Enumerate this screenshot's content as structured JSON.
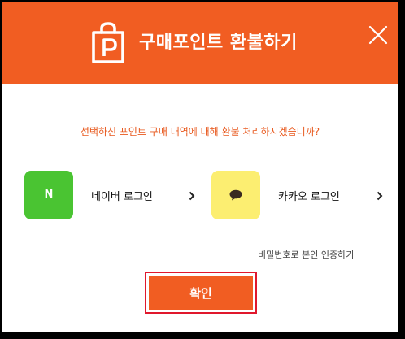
{
  "header": {
    "title": "구매포인트 환불하기",
    "logo_icon": "shopping-bag-p-icon",
    "close_icon": "close-icon",
    "color": "#f15d22"
  },
  "body": {
    "question": "선택하신 포인트 구매 내역에 대해 환불 처리하시겠습니까?"
  },
  "login_options": [
    {
      "service": "naver",
      "icon_letter": "N",
      "label": "네이버 로그인",
      "icon_color": "#4ac432",
      "chevron": "›"
    },
    {
      "service": "kakao",
      "icon": "speech-bubble-icon",
      "label": "카카오 로그인",
      "icon_color": "#fcee71",
      "chevron": "›"
    }
  ],
  "password_link": "비밀번호로 본인 인증하기",
  "confirm_button": "확인",
  "colors": {
    "accent": "#f15d22",
    "highlight_border": "#e0182d",
    "question_text": "#e8591e"
  }
}
